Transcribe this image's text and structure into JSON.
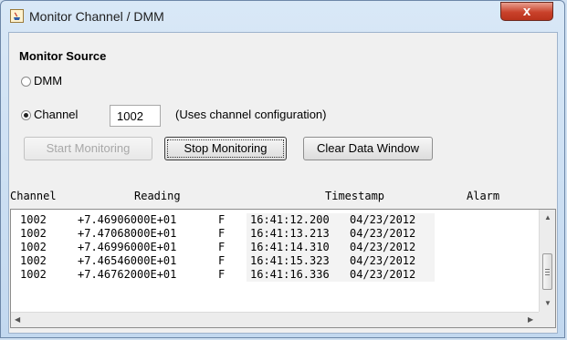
{
  "window": {
    "title": "Monitor Channel / DMM",
    "close_glyph": "x"
  },
  "monitor_source": {
    "title": "Monitor Source",
    "dmm_label": "DMM",
    "dmm_selected": false,
    "channel_label": "Channel",
    "channel_selected": true,
    "channel_value": "1002",
    "channel_note": "(Uses channel configuration)"
  },
  "buttons": {
    "start": "Start Monitoring",
    "stop": "Stop Monitoring",
    "clear": "Clear Data Window"
  },
  "table": {
    "headers": [
      "Channel",
      "Reading",
      "Timestamp",
      "Alarm"
    ],
    "rows": [
      {
        "channel": "1002",
        "reading": "+7.46906000E+01",
        "unit": "F",
        "time": "16:41:12.200",
        "date": "04/23/2012"
      },
      {
        "channel": "1002",
        "reading": "+7.47068000E+01",
        "unit": "F",
        "time": "16:41:13.213",
        "date": "04/23/2012"
      },
      {
        "channel": "1002",
        "reading": "+7.46996000E+01",
        "unit": "F",
        "time": "16:41:14.310",
        "date": "04/23/2012"
      },
      {
        "channel": "1002",
        "reading": "+7.46546000E+01",
        "unit": "F",
        "time": "16:41:15.323",
        "date": "04/23/2012"
      },
      {
        "channel": "1002",
        "reading": "+7.46762000E+01",
        "unit": "F",
        "time": "16:41:16.336",
        "date": "04/23/2012"
      }
    ]
  },
  "icons": {
    "app": "java-app-icon",
    "close": "close-icon",
    "scroll_up": "arrow-up-icon",
    "scroll_down": "arrow-down-icon",
    "scroll_left": "arrow-left-icon",
    "scroll_right": "arrow-right-icon"
  },
  "colors": {
    "close_button": "#c9422b",
    "title_bar": "#c2d8ef"
  }
}
